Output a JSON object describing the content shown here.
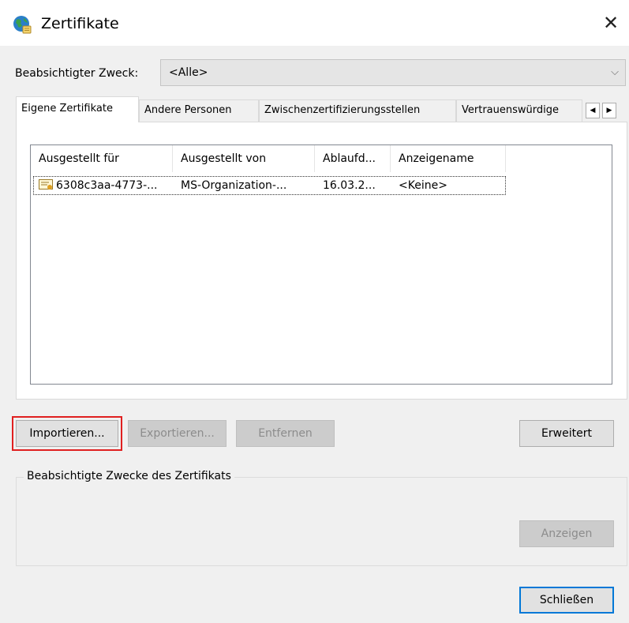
{
  "window": {
    "title": "Zertifikate",
    "close_glyph": "✕",
    "icon": "certificate-globe-icon"
  },
  "purpose": {
    "label": "Beabsichtigter Zweck:",
    "selected": "<Alle>",
    "chevron": "⌵"
  },
  "tabs": [
    {
      "label": "Eigene Zertifikate",
      "active": true
    },
    {
      "label": "Andere Personen",
      "active": false
    },
    {
      "label": "Zwischenzertifizierungsstellen",
      "active": false
    },
    {
      "label": "Vertrauenswürdige",
      "active": false
    }
  ],
  "tab_scroll": {
    "left": "◀",
    "right": "▶"
  },
  "list": {
    "columns": [
      "Ausgestellt für",
      "Ausgestellt von",
      "Ablaufd...",
      "Anzeigename"
    ],
    "rows": [
      [
        "6308c3aa-4773-...",
        "MS-Organization-...",
        "16.03.2...",
        "<Keine>"
      ]
    ]
  },
  "buttons": {
    "import": "Importieren...",
    "export": "Exportieren...",
    "remove": "Entfernen",
    "advanced": "Erweitert",
    "view": "Anzeigen",
    "close": "Schließen"
  },
  "purposes_group": {
    "label": "Beabsichtigte Zwecke des Zertifikats"
  },
  "colors": {
    "highlight": "#e02020",
    "default_button_border": "#0078d7"
  }
}
